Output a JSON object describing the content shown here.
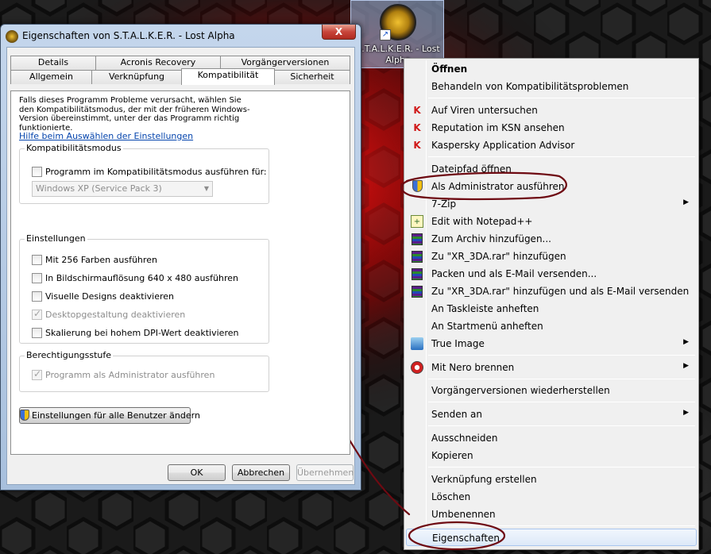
{
  "desktop_icon": {
    "label": "S.T.A.L.K.E.R. - Lost Alpha"
  },
  "dialog": {
    "title": "Eigenschaften von S.T.A.L.K.E.R. - Lost Alpha",
    "close_glyph": "X",
    "tabs_row1": [
      "Details",
      "Acronis Recovery",
      "Vorgängerversionen"
    ],
    "tabs_row2": [
      "Allgemein",
      "Verknüpfung",
      "Kompatibilität",
      "Sicherheit"
    ],
    "active_tab": "Kompatibilität",
    "intro_text": "Falls dieses Programm Probleme verursacht, wählen Sie den Kompatibilitätsmodus, der mit der früheren Windows- Version übereinstimmt, unter der das Programm richtig funktionierte.",
    "help_link": "Hilfe beim Auswählen der Einstellungen",
    "compat_group": {
      "title": "Kompatibilitätsmodus",
      "checkbox_label": "Programm im Kompatibilitätsmodus ausführen für:",
      "checked": false,
      "select_value": "Windows XP (Service Pack 3)"
    },
    "settings_group": {
      "title": "Einstellungen",
      "options": [
        {
          "label": "Mit 256 Farben ausführen",
          "checked": false,
          "disabled": false
        },
        {
          "label": "In Bildschirmauflösung 640 x 480 ausführen",
          "checked": false,
          "disabled": false
        },
        {
          "label": "Visuelle Designs deaktivieren",
          "checked": false,
          "disabled": false
        },
        {
          "label": "Desktopgestaltung deaktivieren",
          "checked": true,
          "disabled": true
        },
        {
          "label": "Skalierung bei hohem DPI-Wert deaktivieren",
          "checked": false,
          "disabled": false
        }
      ]
    },
    "privilege_group": {
      "title": "Berechtigungsstufe",
      "option": {
        "label": "Programm als Administrator ausführen",
        "checked": true,
        "disabled": true
      }
    },
    "all_users_button": "Einstellungen für alle Benutzer ändern",
    "buttons": {
      "ok": "OK",
      "cancel": "Abbrechen",
      "apply": "Übernehmen"
    }
  },
  "context_menu": {
    "items": [
      {
        "label": "Öffnen",
        "bold": true,
        "icon": ""
      },
      {
        "label": "Behandeln von Kompatibilitätsproblemen",
        "icon": ""
      },
      {
        "label": "Auf Viren untersuchen",
        "icon": "kaspersky-icon"
      },
      {
        "label": "Reputation im KSN ansehen",
        "icon": "kaspersky-icon"
      },
      {
        "label": "Kaspersky Application Advisor",
        "icon": "kaspersky-icon"
      },
      {
        "label": "Dateipfad öffnen",
        "icon": ""
      },
      {
        "label": "Als Administrator ausführen",
        "icon": "uac-shield-icon"
      },
      {
        "label": "7-Zip",
        "icon": "",
        "submenu": true
      },
      {
        "label": "Edit with Notepad++",
        "icon": "notepad-plus-plus-icon"
      },
      {
        "label": "Zum Archiv hinzufügen...",
        "icon": "winrar-icon"
      },
      {
        "label": "Zu \"XR_3DA.rar\" hinzufügen",
        "icon": "winrar-icon"
      },
      {
        "label": "Packen und als E-Mail versenden...",
        "icon": "winrar-icon"
      },
      {
        "label": "Zu \"XR_3DA.rar\" hinzufügen und als E-Mail versenden",
        "icon": "winrar-icon"
      },
      {
        "label": "An Taskleiste anheften",
        "icon": ""
      },
      {
        "label": "An Startmenü anheften",
        "icon": ""
      },
      {
        "label": "True Image",
        "icon": "true-image-icon",
        "submenu": true
      },
      {
        "label": "Mit Nero brennen",
        "icon": "nero-icon",
        "submenu": true
      },
      {
        "label": "Vorgängerversionen wiederherstellen",
        "icon": ""
      },
      {
        "label": "Senden an",
        "icon": "",
        "submenu": true
      },
      {
        "label": "Ausschneiden",
        "icon": ""
      },
      {
        "label": "Kopieren",
        "icon": ""
      },
      {
        "label": "Verknüpfung erstellen",
        "icon": ""
      },
      {
        "label": "Löschen",
        "icon": ""
      },
      {
        "label": "Umbenennen",
        "icon": ""
      },
      {
        "label": "Eigenschaften",
        "icon": "",
        "highlighted": true
      }
    ]
  },
  "colors": {
    "annotation": "#6e0a12",
    "link": "#0645ad",
    "kaspersky": "#d01818"
  }
}
